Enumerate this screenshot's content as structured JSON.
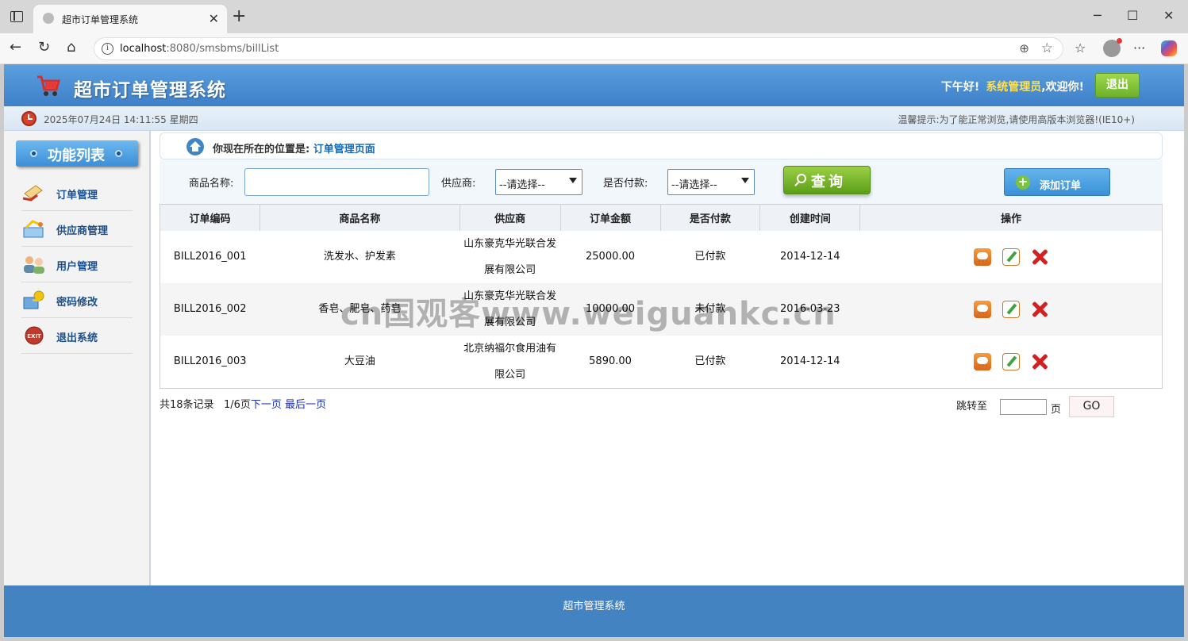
{
  "browser": {
    "tab_title": "超市订单管理系统",
    "url_host": "localhost",
    "url_path": ":8080/smsbms/billList"
  },
  "header": {
    "title": "超市订单管理系统",
    "greeting": "下午好!",
    "username": "系统管理员",
    "welcome": ",欢迎你!",
    "logout_label": "退出"
  },
  "infobar": {
    "datetime": "2025年07月24日 14:11:55 星期四",
    "tip": "温馨提示:为了能正常浏览,请使用高版本浏览器!(IE10+)"
  },
  "sidebar": {
    "title": "功能列表",
    "items": [
      {
        "label": "订单管理",
        "icon": "order-icon"
      },
      {
        "label": "供应商管理",
        "icon": "provider-icon"
      },
      {
        "label": "用户管理",
        "icon": "users-icon"
      },
      {
        "label": "密码修改",
        "icon": "key-icon"
      },
      {
        "label": "退出系统",
        "icon": "exit-icon"
      }
    ]
  },
  "location": {
    "prefix": "你现在所在的位置是:",
    "current": "订单管理页面"
  },
  "search": {
    "product_label": "商品名称:",
    "product_value": "",
    "provider_label": "供应商:",
    "provider_selected": "--请选择--",
    "paid_label": "是否付款:",
    "paid_selected": "--请选择--",
    "query_label": "查询",
    "add_label": "添加订单"
  },
  "table": {
    "headers": [
      "订单编码",
      "商品名称",
      "供应商",
      "订单金额",
      "是否付款",
      "创建时间",
      "操作"
    ],
    "rows": [
      {
        "code": "BILL2016_001",
        "product": "洗发水、护发素",
        "provider": "山东豪克华光联合发展有限公司",
        "amount": "25000.00",
        "paid": "已付款",
        "created": "2014-12-14"
      },
      {
        "code": "BILL2016_002",
        "product": "香皂、肥皂、药皂",
        "provider": "山东豪克华光联合发展有限公司",
        "amount": "10000.00",
        "paid": "未付款",
        "created": "2016-03-23"
      },
      {
        "code": "BILL2016_003",
        "product": "大豆油",
        "provider": "北京纳福尔食用油有限公司",
        "amount": "5890.00",
        "paid": "已付款",
        "created": "2014-12-14"
      }
    ]
  },
  "pager": {
    "total": "共18条记录",
    "page": "1/6页",
    "next": "下一页",
    "last": "最后一页",
    "jump_label": "跳转至",
    "page_unit": "页",
    "go_label": "GO"
  },
  "watermark": "cn国观客www.weiguankc.cn",
  "footer": {
    "text": "超市管理系统"
  },
  "colors": {
    "header_blue": "#3f80c8",
    "footer_blue": "#4383c2",
    "query_green": "#5c9e19",
    "add_blue": "#3b91d8"
  }
}
